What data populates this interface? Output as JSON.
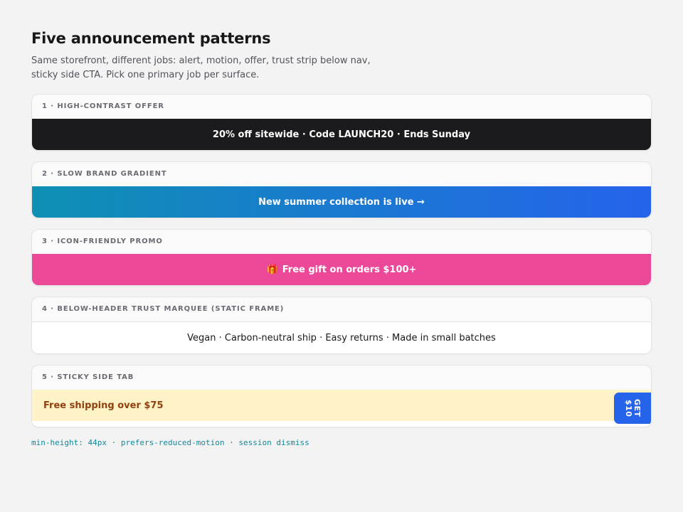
{
  "page": {
    "title": "Five announcement patterns",
    "subtitle": "Same storefront, different jobs: alert, motion, offer, trust strip below nav, sticky side CTA. Pick one primary job per surface."
  },
  "cards": [
    {
      "label": "1 · HIGH-CONTRAST OFFER",
      "text": "20% off sitewide · Code LAUNCH20 · Ends Sunday"
    },
    {
      "label": "2 · SLOW BRAND GRADIENT",
      "text": "New summer collection is live →"
    },
    {
      "label": "3 · ICON-FRIENDLY PROMO",
      "icon": "🎁",
      "text": "Free gift on orders $100+"
    },
    {
      "label": "4 · BELOW-HEADER TRUST MARQUEE (STATIC FRAME)",
      "text": "Vegan · Carbon-neutral ship · Easy returns · Made in small batches"
    },
    {
      "label": "5 · STICKY SIDE TAB",
      "text": "Free shipping over $75",
      "tab_label": "GET\n$10"
    }
  ],
  "footnote": "min-height: 44px · prefers-reduced-motion · session dismiss",
  "colors": {
    "dark_bar": "#1b1b1d",
    "gradient_start": "#0e90b4",
    "gradient_end": "#2563eb",
    "pink_bar": "#ec4899",
    "cream_bar": "#fef3c7",
    "side_tab": "#2563eb",
    "footnote": "#0e8a9b"
  }
}
